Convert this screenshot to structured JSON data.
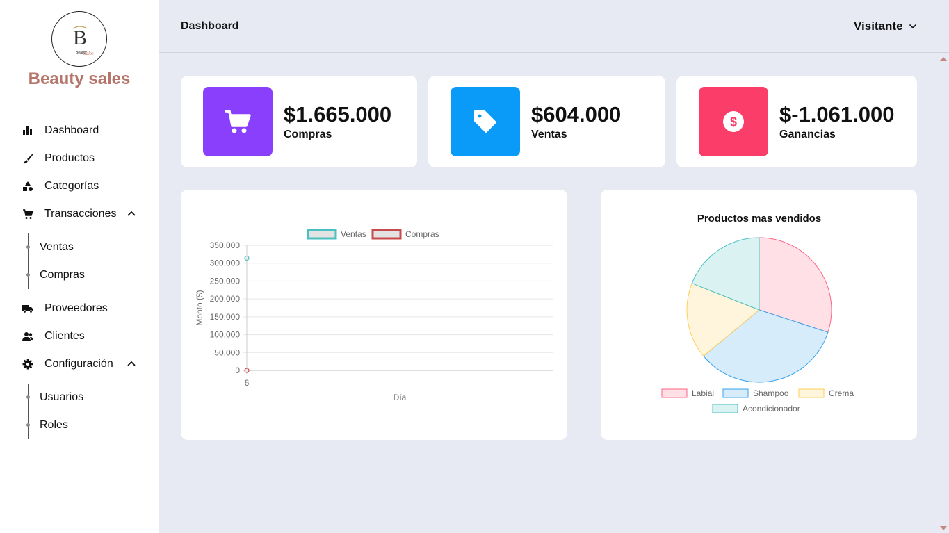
{
  "app": {
    "brand": "Beauty sales",
    "logo_letter": "B",
    "logo_text_1": "Beauty",
    "logo_text_2": "Sales"
  },
  "sidebar": {
    "items": [
      {
        "label": "Dashboard",
        "icon": "bar-chart-icon"
      },
      {
        "label": "Productos",
        "icon": "brush-icon"
      },
      {
        "label": "Categorías",
        "icon": "shapes-icon"
      },
      {
        "label": "Transacciones",
        "icon": "cart-icon",
        "expanded": true,
        "children": [
          "Ventas",
          "Compras"
        ]
      },
      {
        "label": "Proveedores",
        "icon": "truck-icon"
      },
      {
        "label": "Clientes",
        "icon": "users-icon"
      },
      {
        "label": "Configuración",
        "icon": "gear-icon",
        "expanded": true,
        "children": [
          "Usuarios",
          "Roles"
        ]
      }
    ]
  },
  "header": {
    "title": "Dashboard",
    "user": "Visitante"
  },
  "stats": [
    {
      "value": "$1.665.000",
      "label": "Compras",
      "color": "#8a3ffc",
      "icon": "cart-icon"
    },
    {
      "value": "$604.000",
      "label": "Ventas",
      "color": "#0a9af7",
      "icon": "tag-icon"
    },
    {
      "value": "$-1.061.000",
      "label": "Ganancias",
      "color": "#fb3d6a",
      "icon": "dollar-icon"
    }
  ],
  "chart_data": [
    {
      "type": "line",
      "title": "",
      "xlabel": "Día",
      "ylabel": "Monto ($)",
      "categories": [
        "6"
      ],
      "ylim": [
        0,
        350000
      ],
      "yticks": [
        "350.000",
        "300.000",
        "250.000",
        "200.000",
        "150.000",
        "100.000",
        "50.000",
        "0"
      ],
      "legend_position": "top",
      "series": [
        {
          "name": "Ventas",
          "values": [
            314000
          ],
          "color": "#4bc0c0"
        },
        {
          "name": "Compras",
          "values": [
            0
          ],
          "color": "#c94a4a"
        }
      ]
    },
    {
      "type": "pie",
      "title": "Productos mas vendidos",
      "legend_position": "bottom",
      "categories": [
        "Labial",
        "Shampoo",
        "Crema",
        "Acondicionador"
      ],
      "values": [
        30,
        34,
        17,
        19
      ],
      "colors": [
        "#ff6384",
        "#36a2eb",
        "#ffce56",
        "#4bc0c0"
      ]
    }
  ]
}
